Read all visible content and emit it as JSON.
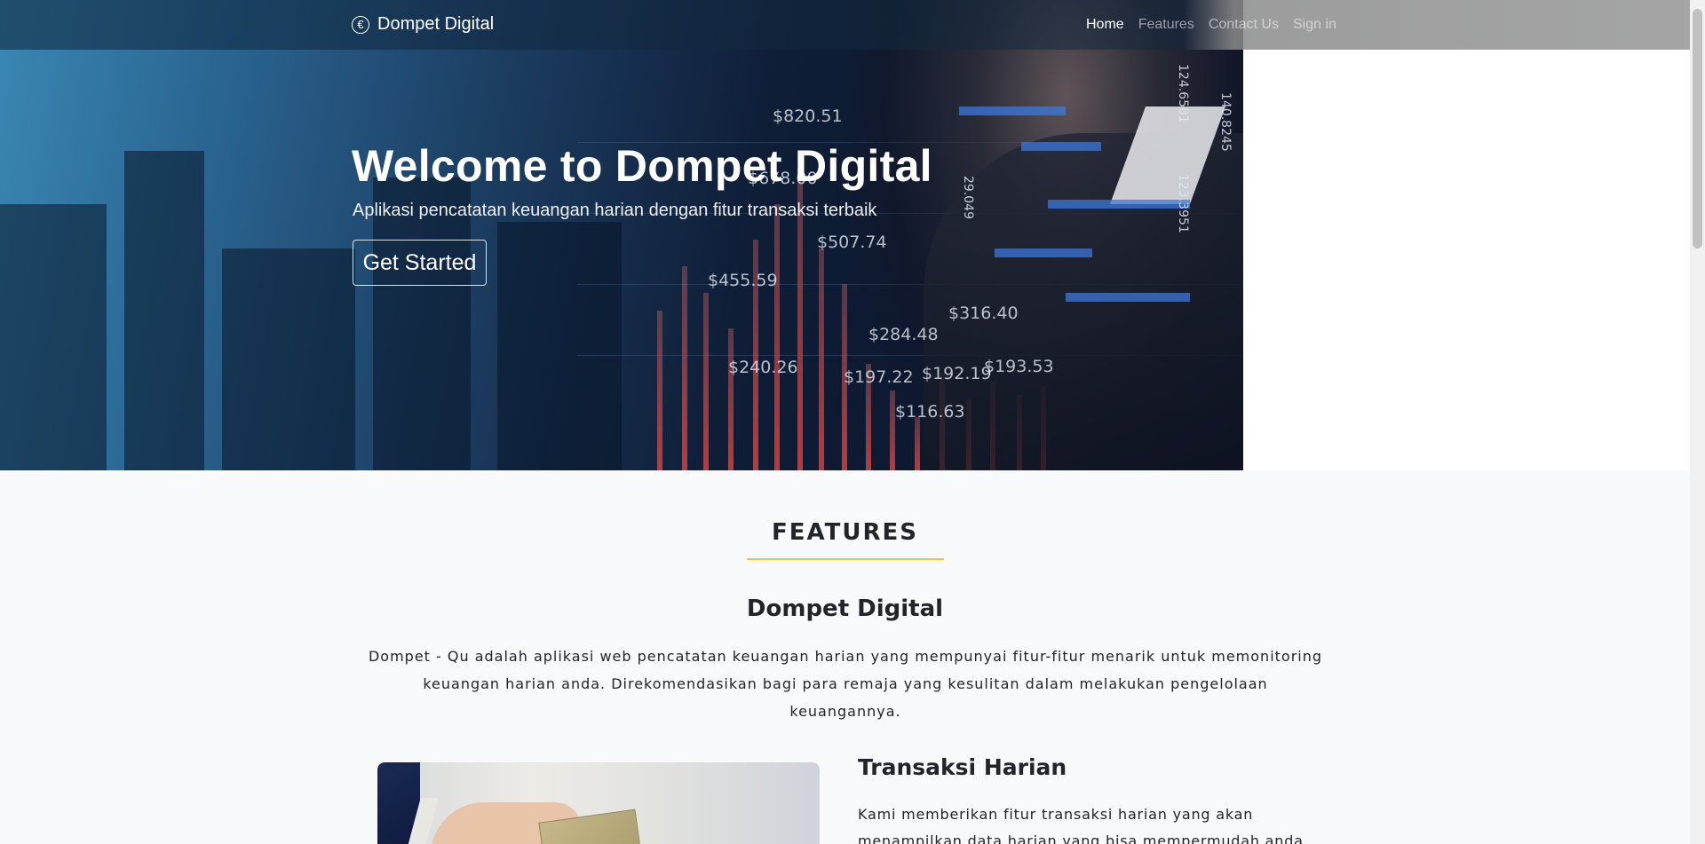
{
  "navbar": {
    "brand": "Dompet Digital",
    "links": [
      {
        "label": "Home",
        "active": true
      },
      {
        "label": "Features",
        "active": false
      },
      {
        "label": "Contact Us",
        "active": false
      },
      {
        "label": "Sign in",
        "active": false
      }
    ]
  },
  "hero": {
    "title": "Welcome to Dompet Digital",
    "subtitle": "Aplikasi pencatatan keuangan harian dengan fitur transaksi terbaik",
    "cta_label": "Get Started",
    "image_prices": [
      "$820.51",
      "$678.00",
      "$507.74",
      "$455.59",
      "$240.26",
      "$284.48",
      "$316.40",
      "$197.22",
      "$192.19",
      "$193.53",
      "$116.63",
      "124.6581",
      "140.8245",
      "123.3951",
      "29.049"
    ]
  },
  "features": {
    "heading": "FEATURES",
    "app_name": "Dompet Digital",
    "app_description": "Dompet - Qu adalah aplikasi web pencatatan keuangan harian yang mempunyai fitur-fitur menarik untuk memonitoring keuangan harian anda. Direkomendasikan bagi para remaja yang kesulitan dalam melakukan pengelolaan keuangannya.",
    "items": [
      {
        "title": "Transaksi Harian",
        "description": "Kami memberikan fitur transaksi harian yang akan menampilkan data harian yang bisa mempermudah anda"
      }
    ]
  },
  "colors": {
    "accent_underline": "#f4c430",
    "page_background": "#f8f9fa"
  }
}
